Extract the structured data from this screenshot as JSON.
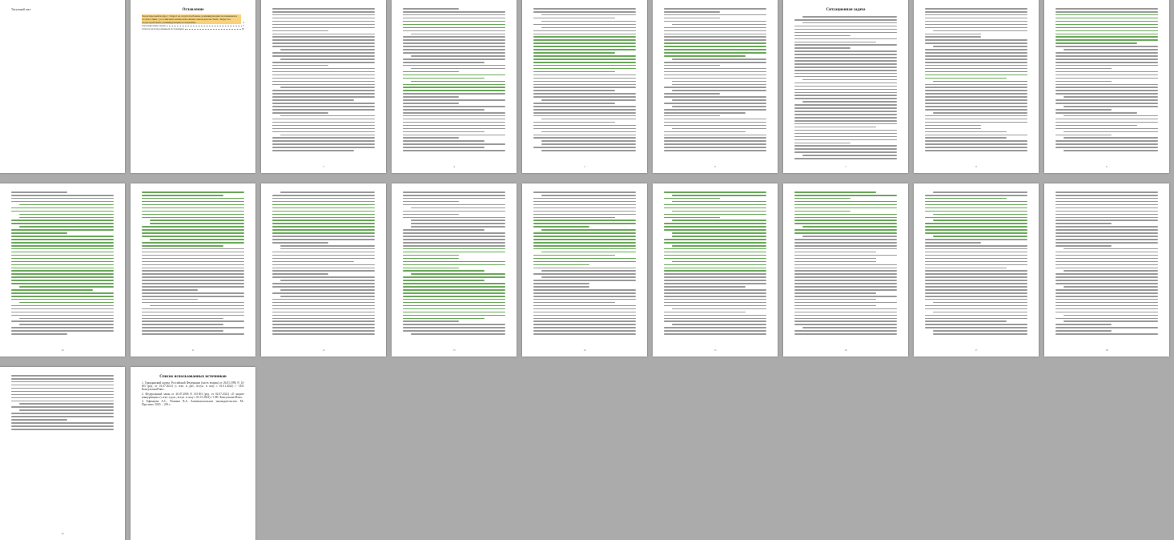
{
  "document": {
    "pages": [
      {
        "id": 1,
        "header": "Титульный лист"
      },
      {
        "id": 2,
        "title": "Оглавление",
        "toc": [
          {
            "text": "Теоретический вопрос: Запрет на злоупотребление доминирующим положением в соответствии с российским антимонопольным законодательством. Запрет на злоупотребление доминирующим положением",
            "page": "3"
          },
          {
            "text": "Ситуационная задача",
            "page": "7"
          },
          {
            "text": "Список использованных источников",
            "page": "10"
          }
        ]
      },
      {
        "id": 3,
        "page_num": "3"
      },
      {
        "id": 4,
        "page_num": "4"
      },
      {
        "id": 5,
        "page_num": "5"
      },
      {
        "id": 6,
        "page_num": "6"
      },
      {
        "id": 7,
        "title": "Ситуационная задача",
        "page_num": "7"
      },
      {
        "id": 8,
        "page_num": "8"
      },
      {
        "id": 9,
        "page_num": "9"
      },
      {
        "id": 10,
        "page_num": "10"
      },
      {
        "id": 11,
        "page_num": "11"
      },
      {
        "id": 12,
        "page_num": "12"
      },
      {
        "id": 13,
        "page_num": "13"
      },
      {
        "id": 14,
        "page_num": "14"
      },
      {
        "id": 15,
        "page_num": "15"
      },
      {
        "id": 16,
        "page_num": "16"
      },
      {
        "id": 17,
        "page_num": "17"
      },
      {
        "id": 18,
        "page_num": "18"
      },
      {
        "id": 19,
        "page_num": "19"
      },
      {
        "id": 20,
        "title": "Список использованных источников",
        "refs": [
          "1. Гражданский кодекс Российской Федерации (часть вторая) от 26.01.1996 N 14-ФЗ (ред. от 01.07.2021) (с изм. и доп., вступ. в силу с 01.01.2022) // СПС КонсультантПлюс.",
          "2. Федеральный закон от 26.07.2006 N 135-ФЗ (ред. от 02.07.2021) «О защите конкуренции» (с изм. и доп., вступ. в силу с 01.01.2022) // СПС КонсультантПлюс.",
          "3. Ефимцева А.С., Поляков В.А. Антимонопольное законодательство. М.: Проспект, 2020. – 256 с."
        ]
      }
    ]
  },
  "colors": {
    "background": "#ababab",
    "page": "#ffffff",
    "highlight": "#6aa85a",
    "toc_highlight": "#f7d27a"
  }
}
